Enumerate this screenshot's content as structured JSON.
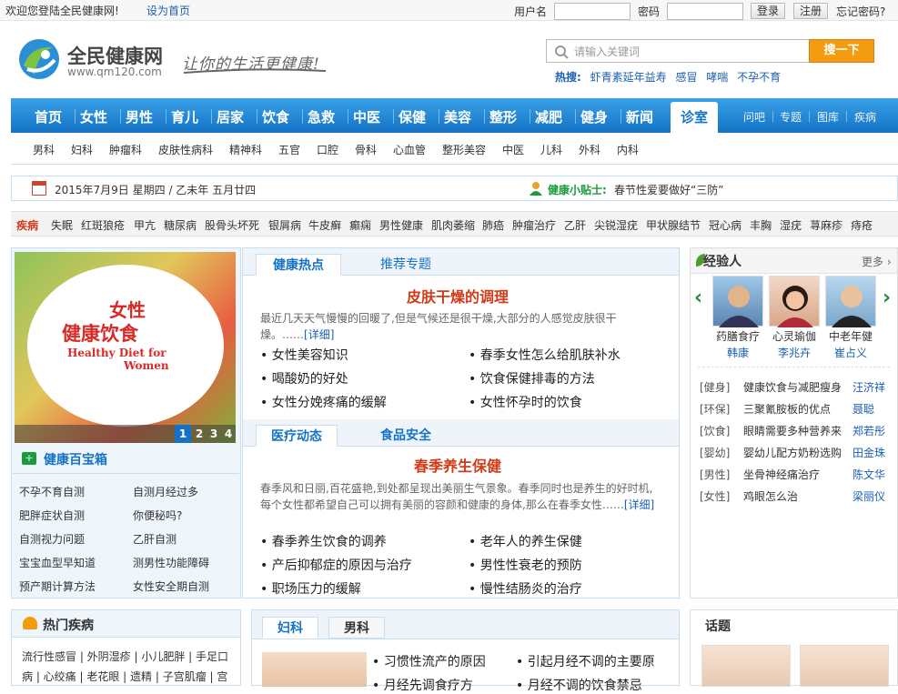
{
  "topbar": {
    "welcome": "欢迎您登陆全民健康网!",
    "set_home": "设为首页",
    "username_label": "用户名",
    "password_label": "密码",
    "login": "登录",
    "register": "注册",
    "forgot": "忘记密码?"
  },
  "header": {
    "logo_title": "全民健康网",
    "logo_url": "www.qm120.com",
    "slogan": "让你的生活更健康!",
    "search_placeholder": "请输入关键词",
    "search_button": "搜一下",
    "hot_label": "热搜:",
    "hot_words": [
      "虾青素延年益寿",
      "感冒",
      "哮喘",
      "不孕不育"
    ]
  },
  "nav": {
    "items": [
      "首页",
      "女性",
      "男性",
      "育儿",
      "居家",
      "饮食",
      "急救",
      "中医",
      "保健",
      "美容",
      "整形",
      "减肥",
      "健身",
      "新闻"
    ],
    "active": "诊室",
    "right": [
      "问吧",
      "专题",
      "图库",
      "疾病"
    ]
  },
  "subnav": [
    "男科",
    "妇科",
    "肿瘤科",
    "皮肤性病科",
    "精神科",
    "五官",
    "口腔",
    "骨科",
    "心血管",
    "整形美容",
    "中医",
    "儿科",
    "外科",
    "内科"
  ],
  "datebar": {
    "date": "2015年7月9日 星期四 / 乙未年 五月廿四",
    "tip_label": "健康小贴士:",
    "tip_text": "春节性爱要做好“三防”"
  },
  "diseases": {
    "label": "疾病",
    "items": [
      "失眠",
      "红斑狼疮",
      "甲亢",
      "糖尿病",
      "股骨头坏死",
      "银屑病",
      "牛皮癣",
      "癫痫",
      "男性健康",
      "肌肉萎缩",
      "肺癌",
      "肿瘤治疗",
      "乙肝",
      "尖锐湿疣",
      "甲状腺结节",
      "冠心病",
      "丰胸",
      "湿疣",
      "荨麻疹",
      "痔疮"
    ]
  },
  "banner": {
    "title1": "女性",
    "title2": "健康饮食",
    "title3": "Healthy Diet for",
    "title4": "Women",
    "pages": [
      "1",
      "2",
      "3",
      "4"
    ]
  },
  "toolbox": {
    "title": "健康百宝箱",
    "items": [
      "不孕不育自测",
      "自测月经过多",
      "肥胖症状自测",
      "你便秘吗?",
      "自测视力问题",
      "乙肝自测",
      "宝宝血型早知道",
      "测男性功能障碍",
      "预产期计算方法",
      "女性安全期自测"
    ]
  },
  "hot_news": {
    "tabs": [
      "健康热点",
      "推荐专题"
    ],
    "title": "皮肤干燥的调理",
    "summary": "最近几天天气慢慢的回暖了,但是气候还是很干燥,大部分的人感觉皮肤很干燥。……",
    "more": "[详细]",
    "items": [
      "女性美容知识",
      "春季女性怎么给肌肤补水",
      "喝酸奶的好处",
      "饮食保健排毒的方法",
      "女性分娩疼痛的缓解",
      "女性怀孕时的饮食"
    ]
  },
  "medical_news": {
    "tabs": [
      "医疗动态",
      "食品安全"
    ],
    "title": "春季养生保健",
    "summary": "春季风和日丽,百花盛艳,到处都呈现出美丽生气景象。春季同时也是养生的好时机,每个女性都希望自己可以拥有美丽的容颜和健康的身体,那么在春季女性……",
    "more": "[详细]",
    "items": [
      "春季养生饮食的调养",
      "老年人的养生保健",
      "产后抑郁症的原因与治疗",
      "男性性衰老的预防",
      "职场压力的缓解",
      "慢性结肠炎的治疗"
    ]
  },
  "experts": {
    "title": "经验人",
    "more": "更多",
    "people": [
      {
        "role": "药膳食疗",
        "name": "韩康"
      },
      {
        "role": "心灵瑜伽",
        "name": "李兆卉"
      },
      {
        "role": "中老年健",
        "name": "崔占义"
      }
    ]
  },
  "qa": [
    {
      "tag": "[健身]",
      "q": "健康饮食与减肥瘦身",
      "a": "汪济祥"
    },
    {
      "tag": "[环保]",
      "q": "三聚氰胺板的优点",
      "a": "聂聪"
    },
    {
      "tag": "[饮食]",
      "q": "眼睛需要多种营养来",
      "a": "郑若彤"
    },
    {
      "tag": "[婴幼]",
      "q": "婴幼儿配方奶粉选购",
      "a": "田金珠"
    },
    {
      "tag": "[男性]",
      "q": "坐骨神经痛治疗",
      "a": "陈文华"
    },
    {
      "tag": "[女性]",
      "q": "鸡眼怎么治",
      "a": "梁丽仪"
    }
  ],
  "hot_diseases": {
    "title": "热门疾病",
    "row1": "流行性感冒 | 外阴湿疹 | 小儿肥胖 | 手足口",
    "row2": "病 | 心绞痛 | 老花眼 | 遗精 | 子宫肌瘤 | 宫"
  },
  "gyn": {
    "tabs": [
      "妇科",
      "男科"
    ],
    "items": [
      "习惯性流产的原因",
      "引起月经不调的主要原",
      "月经先调食疗方",
      "月经不调的饮食禁忌"
    ]
  },
  "topics": {
    "title": "话题"
  }
}
